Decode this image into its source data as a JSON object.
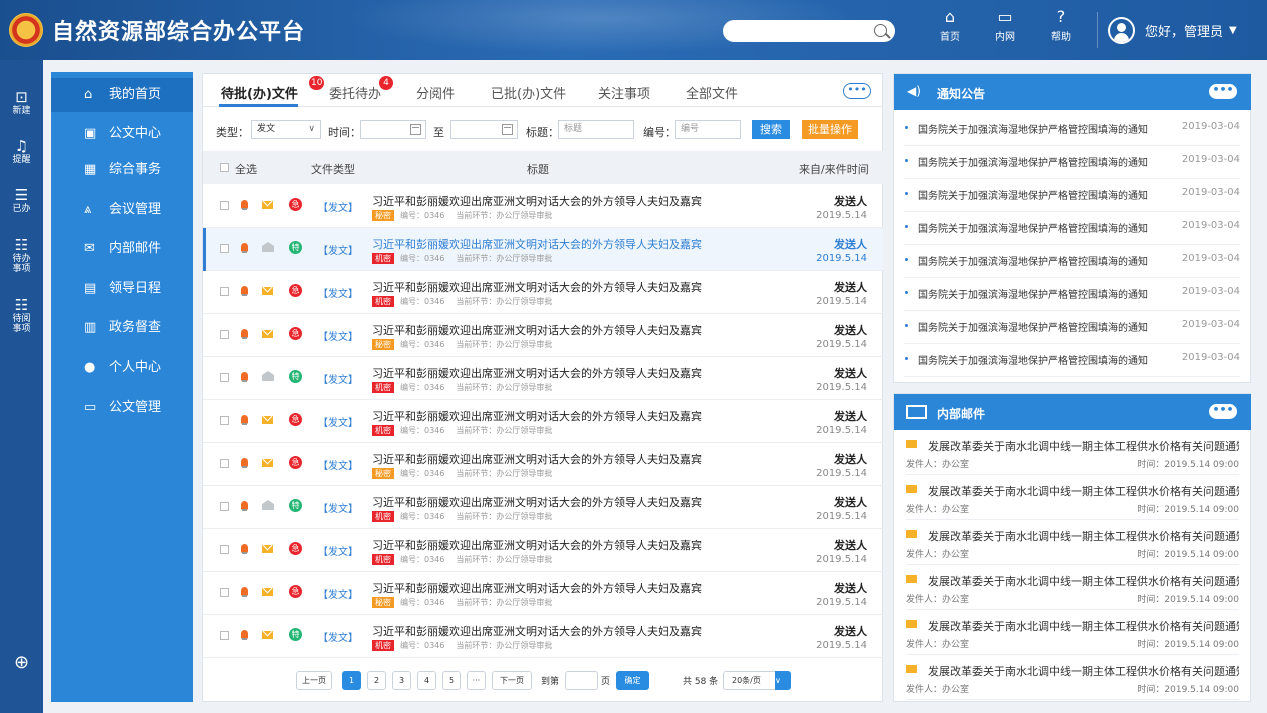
{
  "app": {
    "title": "自然资源部综合办公平台"
  },
  "header": {
    "search_placeholder": "",
    "nav": [
      {
        "label": "首页",
        "icon": "home-icon"
      },
      {
        "label": "内网",
        "icon": "monitor-icon"
      },
      {
        "label": "帮助",
        "icon": "help-icon"
      }
    ],
    "user_greeting": "您好，管理员"
  },
  "iconbar": {
    "items": [
      {
        "label": "新建",
        "icon": "new-doc-icon"
      },
      {
        "label": "提醒",
        "icon": "bell-icon"
      },
      {
        "label": "已办",
        "icon": "done-icon"
      },
      {
        "label": "待办\n事项",
        "icon": "todo-icon"
      },
      {
        "label": "待阅\n事项",
        "icon": "to-read-icon"
      }
    ],
    "add_icon": "plus-circle-icon"
  },
  "sidebar": {
    "items": [
      {
        "label": "我的首页",
        "icon": "home-icon",
        "active": true
      },
      {
        "label": "公文中心",
        "icon": "briefcase-icon"
      },
      {
        "label": "综合事务",
        "icon": "building-icon"
      },
      {
        "label": "会议管理",
        "icon": "meeting-icon"
      },
      {
        "label": "内部邮件",
        "icon": "mail-icon"
      },
      {
        "label": "领导日程",
        "icon": "calendar-icon"
      },
      {
        "label": "政务督查",
        "icon": "inspect-icon"
      },
      {
        "label": "个人中心",
        "icon": "user-icon"
      },
      {
        "label": "公文管理",
        "icon": "archive-icon"
      }
    ]
  },
  "main": {
    "tabs": [
      {
        "label": "待批(办)文件",
        "badge": "10",
        "active": true
      },
      {
        "label": "委托待办",
        "badge": "4"
      },
      {
        "label": "分阅件"
      },
      {
        "label": "已批(办)文件"
      },
      {
        "label": "关注事项"
      },
      {
        "label": "全部文件"
      }
    ],
    "more": "•••",
    "filter": {
      "type_label": "类型：",
      "type_value": "发文",
      "time_label": "时间：",
      "to_label": "至",
      "title_label": "标题：",
      "title_placeholder": "标题",
      "number_label": "编号：",
      "number_placeholder": "编号",
      "search_button": "搜索",
      "batch_button": "批量操作"
    },
    "table_header": {
      "select_all": "全选",
      "doc_type": "文件类型",
      "title": "标题",
      "from_time": "来自/来件时间"
    },
    "rows": [
      {
        "mail": "mail",
        "urgency": "急",
        "type": "【发文】",
        "title": "习近平和彭丽媛欢迎出席亚洲文明对话大会的外方领导人夫妇及嘉宾",
        "secret": "秘密",
        "number": "编号：0346",
        "stage": "当前环节：办公厅领导审批",
        "from": "发送人",
        "date": "2019.5.14"
      },
      {
        "mail": "open",
        "urgency": "特",
        "type": "【发文】",
        "title": "习近平和彭丽媛欢迎出席亚洲文明对话大会的外方领导人夫妇及嘉宾",
        "secret": "机密",
        "number": "编号：0346",
        "stage": "当前环节：办公厅领导审批",
        "from": "发送人",
        "date": "2019.5.14",
        "highlight": true
      },
      {
        "mail": "mail",
        "urgency": "急",
        "type": "【发文】",
        "title": "习近平和彭丽媛欢迎出席亚洲文明对话大会的外方领导人夫妇及嘉宾",
        "secret": "机密",
        "number": "编号：0346",
        "stage": "当前环节：办公厅领导审批",
        "from": "发送人",
        "date": "2019.5.14"
      },
      {
        "mail": "mail",
        "urgency": "急",
        "type": "【发文】",
        "title": "习近平和彭丽媛欢迎出席亚洲文明对话大会的外方领导人夫妇及嘉宾",
        "secret": "秘密",
        "number": "编号：0346",
        "stage": "当前环节：办公厅领导审批",
        "from": "发送人",
        "date": "2019.5.14"
      },
      {
        "mail": "open",
        "urgency": "特",
        "type": "【发文】",
        "title": "习近平和彭丽媛欢迎出席亚洲文明对话大会的外方领导人夫妇及嘉宾",
        "secret": "机密",
        "number": "编号：0346",
        "stage": "当前环节：办公厅领导审批",
        "from": "发送人",
        "date": "2019.5.14"
      },
      {
        "mail": "mail",
        "urgency": "急",
        "type": "【发文】",
        "title": "习近平和彭丽媛欢迎出席亚洲文明对话大会的外方领导人夫妇及嘉宾",
        "secret": "机密",
        "number": "编号：0346",
        "stage": "当前环节：办公厅领导审批",
        "from": "发送人",
        "date": "2019.5.14"
      },
      {
        "mail": "mail",
        "urgency": "急",
        "type": "【发文】",
        "title": "习近平和彭丽媛欢迎出席亚洲文明对话大会的外方领导人夫妇及嘉宾",
        "secret": "秘密",
        "number": "编号：0346",
        "stage": "当前环节：办公厅领导审批",
        "from": "发送人",
        "date": "2019.5.14"
      },
      {
        "mail": "open",
        "urgency": "特",
        "type": "【发文】",
        "title": "习近平和彭丽媛欢迎出席亚洲文明对话大会的外方领导人夫妇及嘉宾",
        "secret": "机密",
        "number": "编号：0346",
        "stage": "当前环节：办公厅领导审批",
        "from": "发送人",
        "date": "2019.5.14"
      },
      {
        "mail": "mail",
        "urgency": "急",
        "type": "【发文】",
        "title": "习近平和彭丽媛欢迎出席亚洲文明对话大会的外方领导人夫妇及嘉宾",
        "secret": "机密",
        "number": "编号：0346",
        "stage": "当前环节：办公厅领导审批",
        "from": "发送人",
        "date": "2019.5.14"
      },
      {
        "mail": "mail",
        "urgency": "急",
        "type": "【发文】",
        "title": "习近平和彭丽媛欢迎出席亚洲文明对话大会的外方领导人夫妇及嘉宾",
        "secret": "秘密",
        "number": "编号：0346",
        "stage": "当前环节：办公厅领导审批",
        "from": "发送人",
        "date": "2019.5.14"
      },
      {
        "mail": "mail",
        "urgency": "特",
        "type": "【发文】",
        "title": "习近平和彭丽媛欢迎出席亚洲文明对话大会的外方领导人夫妇及嘉宾",
        "secret": "机密",
        "number": "编号：0346",
        "stage": "当前环节：办公厅领导审批",
        "from": "发送人",
        "date": "2019.5.14"
      }
    ],
    "pager": {
      "prev": "上一页",
      "pages": [
        "1",
        "2",
        "3",
        "4",
        "5",
        "···"
      ],
      "current": "1",
      "next": "下一页",
      "goto_label": "到第",
      "page_label": "页",
      "confirm": "确定",
      "total": "共 58 条",
      "per_page": "20条/页"
    }
  },
  "notices": {
    "title": "通知公告",
    "more": "•••",
    "items": [
      {
        "text": "国务院关于加强滨海湿地保护严格管控围填海的通知",
        "date": "2019-03-04"
      },
      {
        "text": "国务院关于加强滨海湿地保护严格管控围填海的通知",
        "date": "2019-03-04"
      },
      {
        "text": "国务院关于加强滨海湿地保护严格管控围填海的通知",
        "date": "2019-03-04"
      },
      {
        "text": "国务院关于加强滨海湿地保护严格管控围填海的通知",
        "date": "2019-03-04"
      },
      {
        "text": "国务院关于加强滨海湿地保护严格管控围填海的通知",
        "date": "2019-03-04"
      },
      {
        "text": "国务院关于加强滨海湿地保护严格管控围填海的通知",
        "date": "2019-03-04"
      },
      {
        "text": "国务院关于加强滨海湿地保护严格管控围填海的通知",
        "date": "2019-03-04"
      },
      {
        "text": "国务院关于加强滨海湿地保护严格管控围填海的通知",
        "date": "2019-03-04"
      }
    ]
  },
  "mail": {
    "title": "内部邮件",
    "more": "•••",
    "items": [
      {
        "title": "发展改革委关于南水北调中线一期主体工程供水价格有关问题通知...",
        "sender": "发件人：办公室",
        "time": "时间：2019.5.14  09:00"
      },
      {
        "title": "发展改革委关于南水北调中线一期主体工程供水价格有关问题通知...",
        "sender": "发件人：办公室",
        "time": "时间：2019.5.14  09:00"
      },
      {
        "title": "发展改革委关于南水北调中线一期主体工程供水价格有关问题通知...",
        "sender": "发件人：办公室",
        "time": "时间：2019.5.14  09:00"
      },
      {
        "title": "发展改革委关于南水北调中线一期主体工程供水价格有关问题通知...",
        "sender": "发件人：办公室",
        "time": "时间：2019.5.14  09:00"
      },
      {
        "title": "发展改革委关于南水北调中线一期主体工程供水价格有关问题通知...",
        "sender": "发件人：办公室",
        "time": "时间：2019.5.14  09:00"
      },
      {
        "title": "发展改革委关于南水北调中线一期主体工程供水价格有关问题通知...",
        "sender": "发件人：办公室",
        "time": "时间：2019.5.14  09:00"
      }
    ]
  },
  "colors": {
    "primary": "#2b86d8",
    "header": "#1f5496",
    "urgent": "#e8242c",
    "special": "#22b573",
    "secret_orange": "#f59a23",
    "secret_red": "#e8242c"
  }
}
